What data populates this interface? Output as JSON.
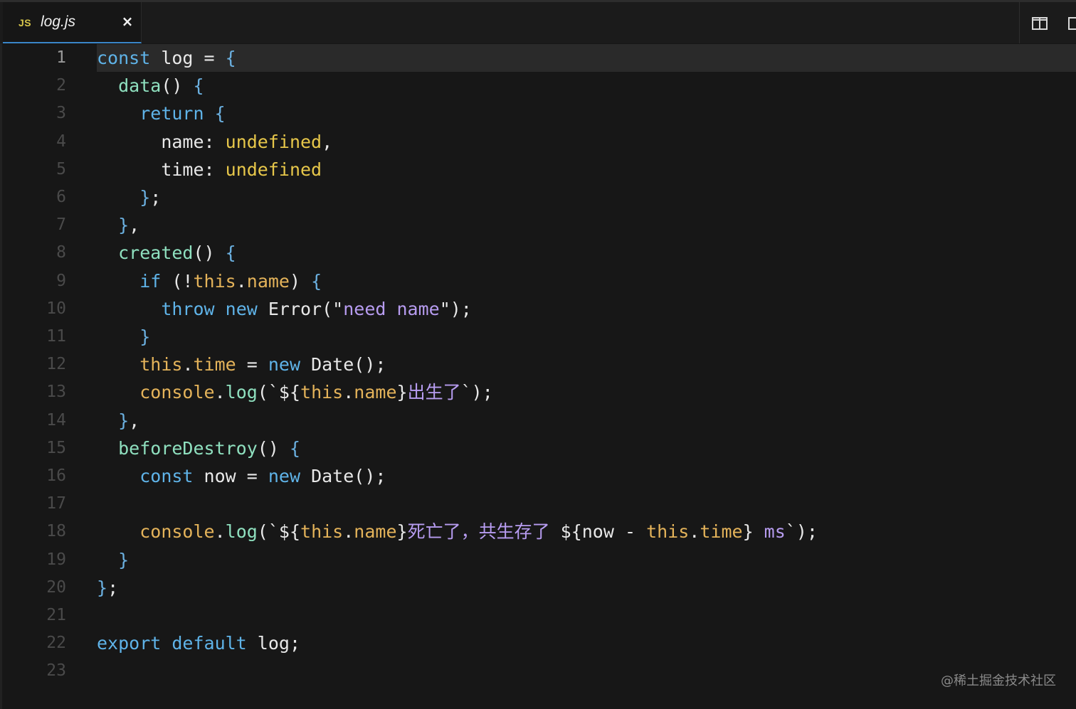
{
  "tab": {
    "icon_label": "JS",
    "title": "log.js",
    "close_label": "×"
  },
  "editor": {
    "active_line": 1,
    "lines": [
      {
        "n": "1"
      },
      {
        "n": "2"
      },
      {
        "n": "3"
      },
      {
        "n": "4"
      },
      {
        "n": "5"
      },
      {
        "n": "6"
      },
      {
        "n": "7"
      },
      {
        "n": "8"
      },
      {
        "n": "9"
      },
      {
        "n": "10"
      },
      {
        "n": "11"
      },
      {
        "n": "12"
      },
      {
        "n": "13"
      },
      {
        "n": "14"
      },
      {
        "n": "15"
      },
      {
        "n": "16"
      },
      {
        "n": "17"
      },
      {
        "n": "18"
      },
      {
        "n": "19"
      },
      {
        "n": "20"
      },
      {
        "n": "21"
      },
      {
        "n": "22"
      },
      {
        "n": "23"
      }
    ],
    "code": {
      "l1": [
        [
          "kw",
          "const"
        ],
        [
          "id",
          " log "
        ],
        [
          "pun",
          "= "
        ],
        [
          "br",
          "{"
        ]
      ],
      "l2": [
        [
          "pun",
          "  "
        ],
        [
          "fn",
          "data"
        ],
        [
          "pun",
          "() "
        ],
        [
          "br",
          "{"
        ]
      ],
      "l3": [
        [
          "pun",
          "    "
        ],
        [
          "kw",
          "return"
        ],
        [
          "pun",
          " "
        ],
        [
          "br",
          "{"
        ]
      ],
      "l4": [
        [
          "pun",
          "      "
        ],
        [
          "id",
          "name"
        ],
        [
          "pun",
          ": "
        ],
        [
          "und",
          "undefined"
        ],
        [
          "pun",
          ","
        ]
      ],
      "l5": [
        [
          "pun",
          "      "
        ],
        [
          "id",
          "time"
        ],
        [
          "pun",
          ": "
        ],
        [
          "und",
          "undefined"
        ]
      ],
      "l6": [
        [
          "pun",
          "    "
        ],
        [
          "br",
          "}"
        ],
        [
          "pun",
          ";"
        ]
      ],
      "l7": [
        [
          "pun",
          "  "
        ],
        [
          "br",
          "}"
        ],
        [
          "pun",
          ","
        ]
      ],
      "l8": [
        [
          "pun",
          "  "
        ],
        [
          "fn",
          "created"
        ],
        [
          "pun",
          "() "
        ],
        [
          "br",
          "{"
        ]
      ],
      "l9": [
        [
          "pun",
          "    "
        ],
        [
          "kw",
          "if"
        ],
        [
          "pun",
          " (!"
        ],
        [
          "th",
          "this"
        ],
        [
          "pun",
          "."
        ],
        [
          "pr",
          "name"
        ],
        [
          "pun",
          ") "
        ],
        [
          "br",
          "{"
        ]
      ],
      "l10": [
        [
          "pun",
          "      "
        ],
        [
          "kw",
          "throw"
        ],
        [
          "pun",
          " "
        ],
        [
          "kw",
          "new"
        ],
        [
          "id",
          " Error"
        ],
        [
          "pun",
          "(\""
        ],
        [
          "str",
          "need name"
        ],
        [
          "pun",
          "\");"
        ]
      ],
      "l11": [
        [
          "pun",
          "    "
        ],
        [
          "br",
          "}"
        ]
      ],
      "l12": [
        [
          "pun",
          "    "
        ],
        [
          "th",
          "this"
        ],
        [
          "pun",
          "."
        ],
        [
          "pr",
          "time"
        ],
        [
          "pun",
          " = "
        ],
        [
          "kw",
          "new"
        ],
        [
          "id",
          " Date"
        ],
        [
          "pun",
          "();"
        ]
      ],
      "l13": [
        [
          "pun",
          "    "
        ],
        [
          "th",
          "console"
        ],
        [
          "pun",
          "."
        ],
        [
          "fn",
          "log"
        ],
        [
          "pun",
          "(`${"
        ],
        [
          "th",
          "this"
        ],
        [
          "pun",
          "."
        ],
        [
          "pr",
          "name"
        ],
        [
          "pun",
          "}"
        ],
        [
          "str",
          "出生了"
        ],
        [
          "pun",
          "`);"
        ]
      ],
      "l14": [
        [
          "pun",
          "  "
        ],
        [
          "br",
          "}"
        ],
        [
          "pun",
          ","
        ]
      ],
      "l15": [
        [
          "pun",
          "  "
        ],
        [
          "fn",
          "beforeDestroy"
        ],
        [
          "pun",
          "() "
        ],
        [
          "br",
          "{"
        ]
      ],
      "l16": [
        [
          "pun",
          "    "
        ],
        [
          "kw",
          "const"
        ],
        [
          "id",
          " now"
        ],
        [
          "pun",
          " = "
        ],
        [
          "kw",
          "new"
        ],
        [
          "id",
          " Date"
        ],
        [
          "pun",
          "();"
        ]
      ],
      "l17": [],
      "l18": [
        [
          "pun",
          "    "
        ],
        [
          "th",
          "console"
        ],
        [
          "pun",
          "."
        ],
        [
          "fn",
          "log"
        ],
        [
          "pun",
          "(`${"
        ],
        [
          "th",
          "this"
        ],
        [
          "pun",
          "."
        ],
        [
          "pr",
          "name"
        ],
        [
          "pun",
          "}"
        ],
        [
          "str",
          "死亡了，共生存了 "
        ],
        [
          "pun",
          "${"
        ],
        [
          "id",
          "now"
        ],
        [
          "pun",
          " - "
        ],
        [
          "th",
          "this"
        ],
        [
          "pun",
          "."
        ],
        [
          "pr",
          "time"
        ],
        [
          "pun",
          "} "
        ],
        [
          "str",
          "ms"
        ],
        [
          "pun",
          "`);"
        ]
      ],
      "l19": [
        [
          "pun",
          "  "
        ],
        [
          "br",
          "}"
        ]
      ],
      "l20": [
        [
          "br",
          "}"
        ],
        [
          "pun",
          ";"
        ]
      ],
      "l21": [],
      "l22": [
        [
          "kw",
          "export"
        ],
        [
          "pun",
          " "
        ],
        [
          "kw",
          "default"
        ],
        [
          "id",
          " log"
        ],
        [
          "pun",
          ";"
        ]
      ],
      "l23": []
    }
  },
  "watermark": "@稀土掘金技术社区",
  "icons": {
    "split_editor": "split-editor-icon",
    "more_actions": "more-actions-icon"
  }
}
